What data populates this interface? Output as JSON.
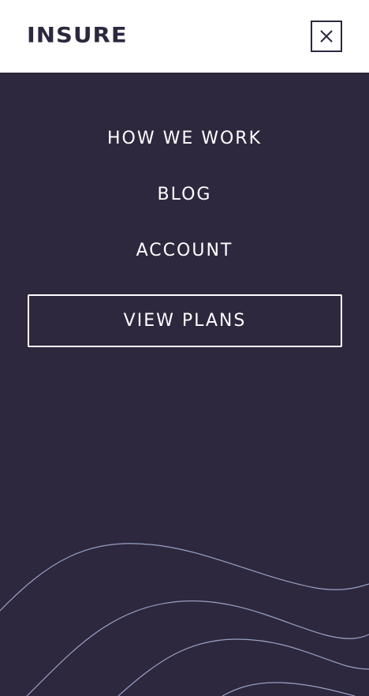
{
  "header": {
    "logo": "INSURE",
    "close_icon": "close-icon"
  },
  "menu": {
    "items": [
      {
        "label": "HOW WE WORK"
      },
      {
        "label": "BLOG"
      },
      {
        "label": "ACCOUNT"
      }
    ],
    "cta_label": "VIEW PLANS"
  },
  "colors": {
    "primary_dark": "#2d283e",
    "white": "#ffffff",
    "wave_stroke": "#9aa0c4"
  }
}
